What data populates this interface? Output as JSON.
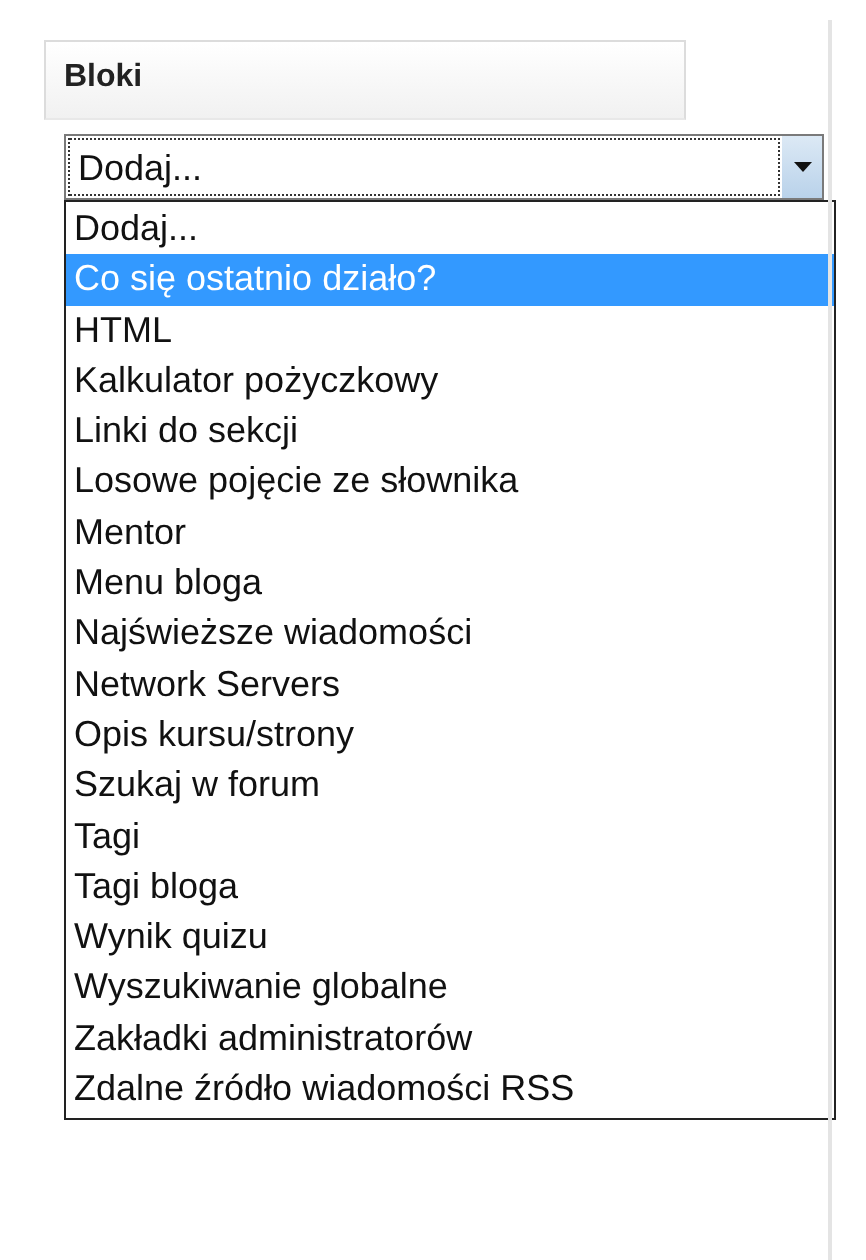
{
  "block": {
    "title": "Bloki"
  },
  "select": {
    "value": "Dodaj..."
  },
  "options": [
    {
      "label": "Dodaj...",
      "selected": false
    },
    {
      "label": "Co się ostatnio działo?",
      "selected": true
    },
    {
      "label": "HTML",
      "selected": false
    },
    {
      "label": "Kalkulator pożyczkowy",
      "selected": false
    },
    {
      "label": "Linki do sekcji",
      "selected": false
    },
    {
      "label": "Losowe pojęcie ze słownika",
      "selected": false
    },
    {
      "label": "Mentor",
      "selected": false
    },
    {
      "label": "Menu bloga",
      "selected": false
    },
    {
      "label": "Najświeższe wiadomości",
      "selected": false
    },
    {
      "label": "Network Servers",
      "selected": false
    },
    {
      "label": "Opis kursu/strony",
      "selected": false
    },
    {
      "label": "Szukaj w forum",
      "selected": false
    },
    {
      "label": "Tagi",
      "selected": false
    },
    {
      "label": "Tagi bloga",
      "selected": false
    },
    {
      "label": "Wynik quizu",
      "selected": false
    },
    {
      "label": "Wyszukiwanie globalne",
      "selected": false
    },
    {
      "label": "Zakładki administratorów",
      "selected": false
    },
    {
      "label": "Zdalne źródło wiadomości RSS",
      "selected": false
    }
  ]
}
